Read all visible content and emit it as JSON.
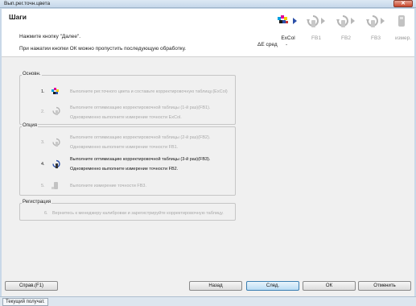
{
  "window": {
    "title": "Вып.рег.точн.цвета",
    "close_label": "✕"
  },
  "header": {
    "title": "Шаги",
    "line1": "Нажмите кнопку \"Далее\".",
    "line2": "При нажатии кнопки ОК можно пропустить последующую обработку."
  },
  "stepper": [
    {
      "label": "ExCol",
      "active": true
    },
    {
      "label": "FB1",
      "active": false
    },
    {
      "label": "FB2",
      "active": false
    },
    {
      "label": "FB3",
      "active": false
    },
    {
      "label": "измер.",
      "active": false
    }
  ],
  "delta_e": {
    "label": "ΔE сред",
    "value": "-"
  },
  "groups": {
    "basic": {
      "title": "Основн.",
      "steps": [
        {
          "num": "1.",
          "lines": [
            "Выполните рег.точного цвета и составьте корректировочную таблицу.(ExCol)"
          ]
        },
        {
          "num": "2.",
          "lines": [
            "Выполните оптимизацию корректировочной таблицы (1-й раз)(FB1).",
            "Одновременно выполните измерение точности ExCol."
          ]
        }
      ]
    },
    "option": {
      "title": "Опция",
      "steps": [
        {
          "num": "3.",
          "lines": [
            "Выполните оптимизацию корректировочной таблицы (2-й раз)(FB2).",
            "Одновременно выполните измерение точности FB1."
          ]
        },
        {
          "num": "4.",
          "lines": [
            "Выполните оптимизацию корректировочной таблицы (3-й раз)(FB3).",
            "Одновременно выполните измерение точности FB2."
          ]
        },
        {
          "num": "5.",
          "lines": [
            "Выполните измерение точности FB3."
          ]
        }
      ]
    },
    "register": {
      "title": "Регистрация",
      "steps": [
        {
          "num": "6.",
          "lines": [
            "Вернитесь к менеджеру калибровки и зарегистрируйте корректировочную таблицу."
          ]
        }
      ]
    }
  },
  "buttons": {
    "help": "Справ.(F1)",
    "back": "Назад",
    "next": "След.",
    "ok": "ОК",
    "cancel": "Отменить"
  },
  "status": {
    "text": "Текущий получат."
  },
  "colors": {
    "accent": "#2b4fa8",
    "disabled_text": "#a8a8a8"
  }
}
